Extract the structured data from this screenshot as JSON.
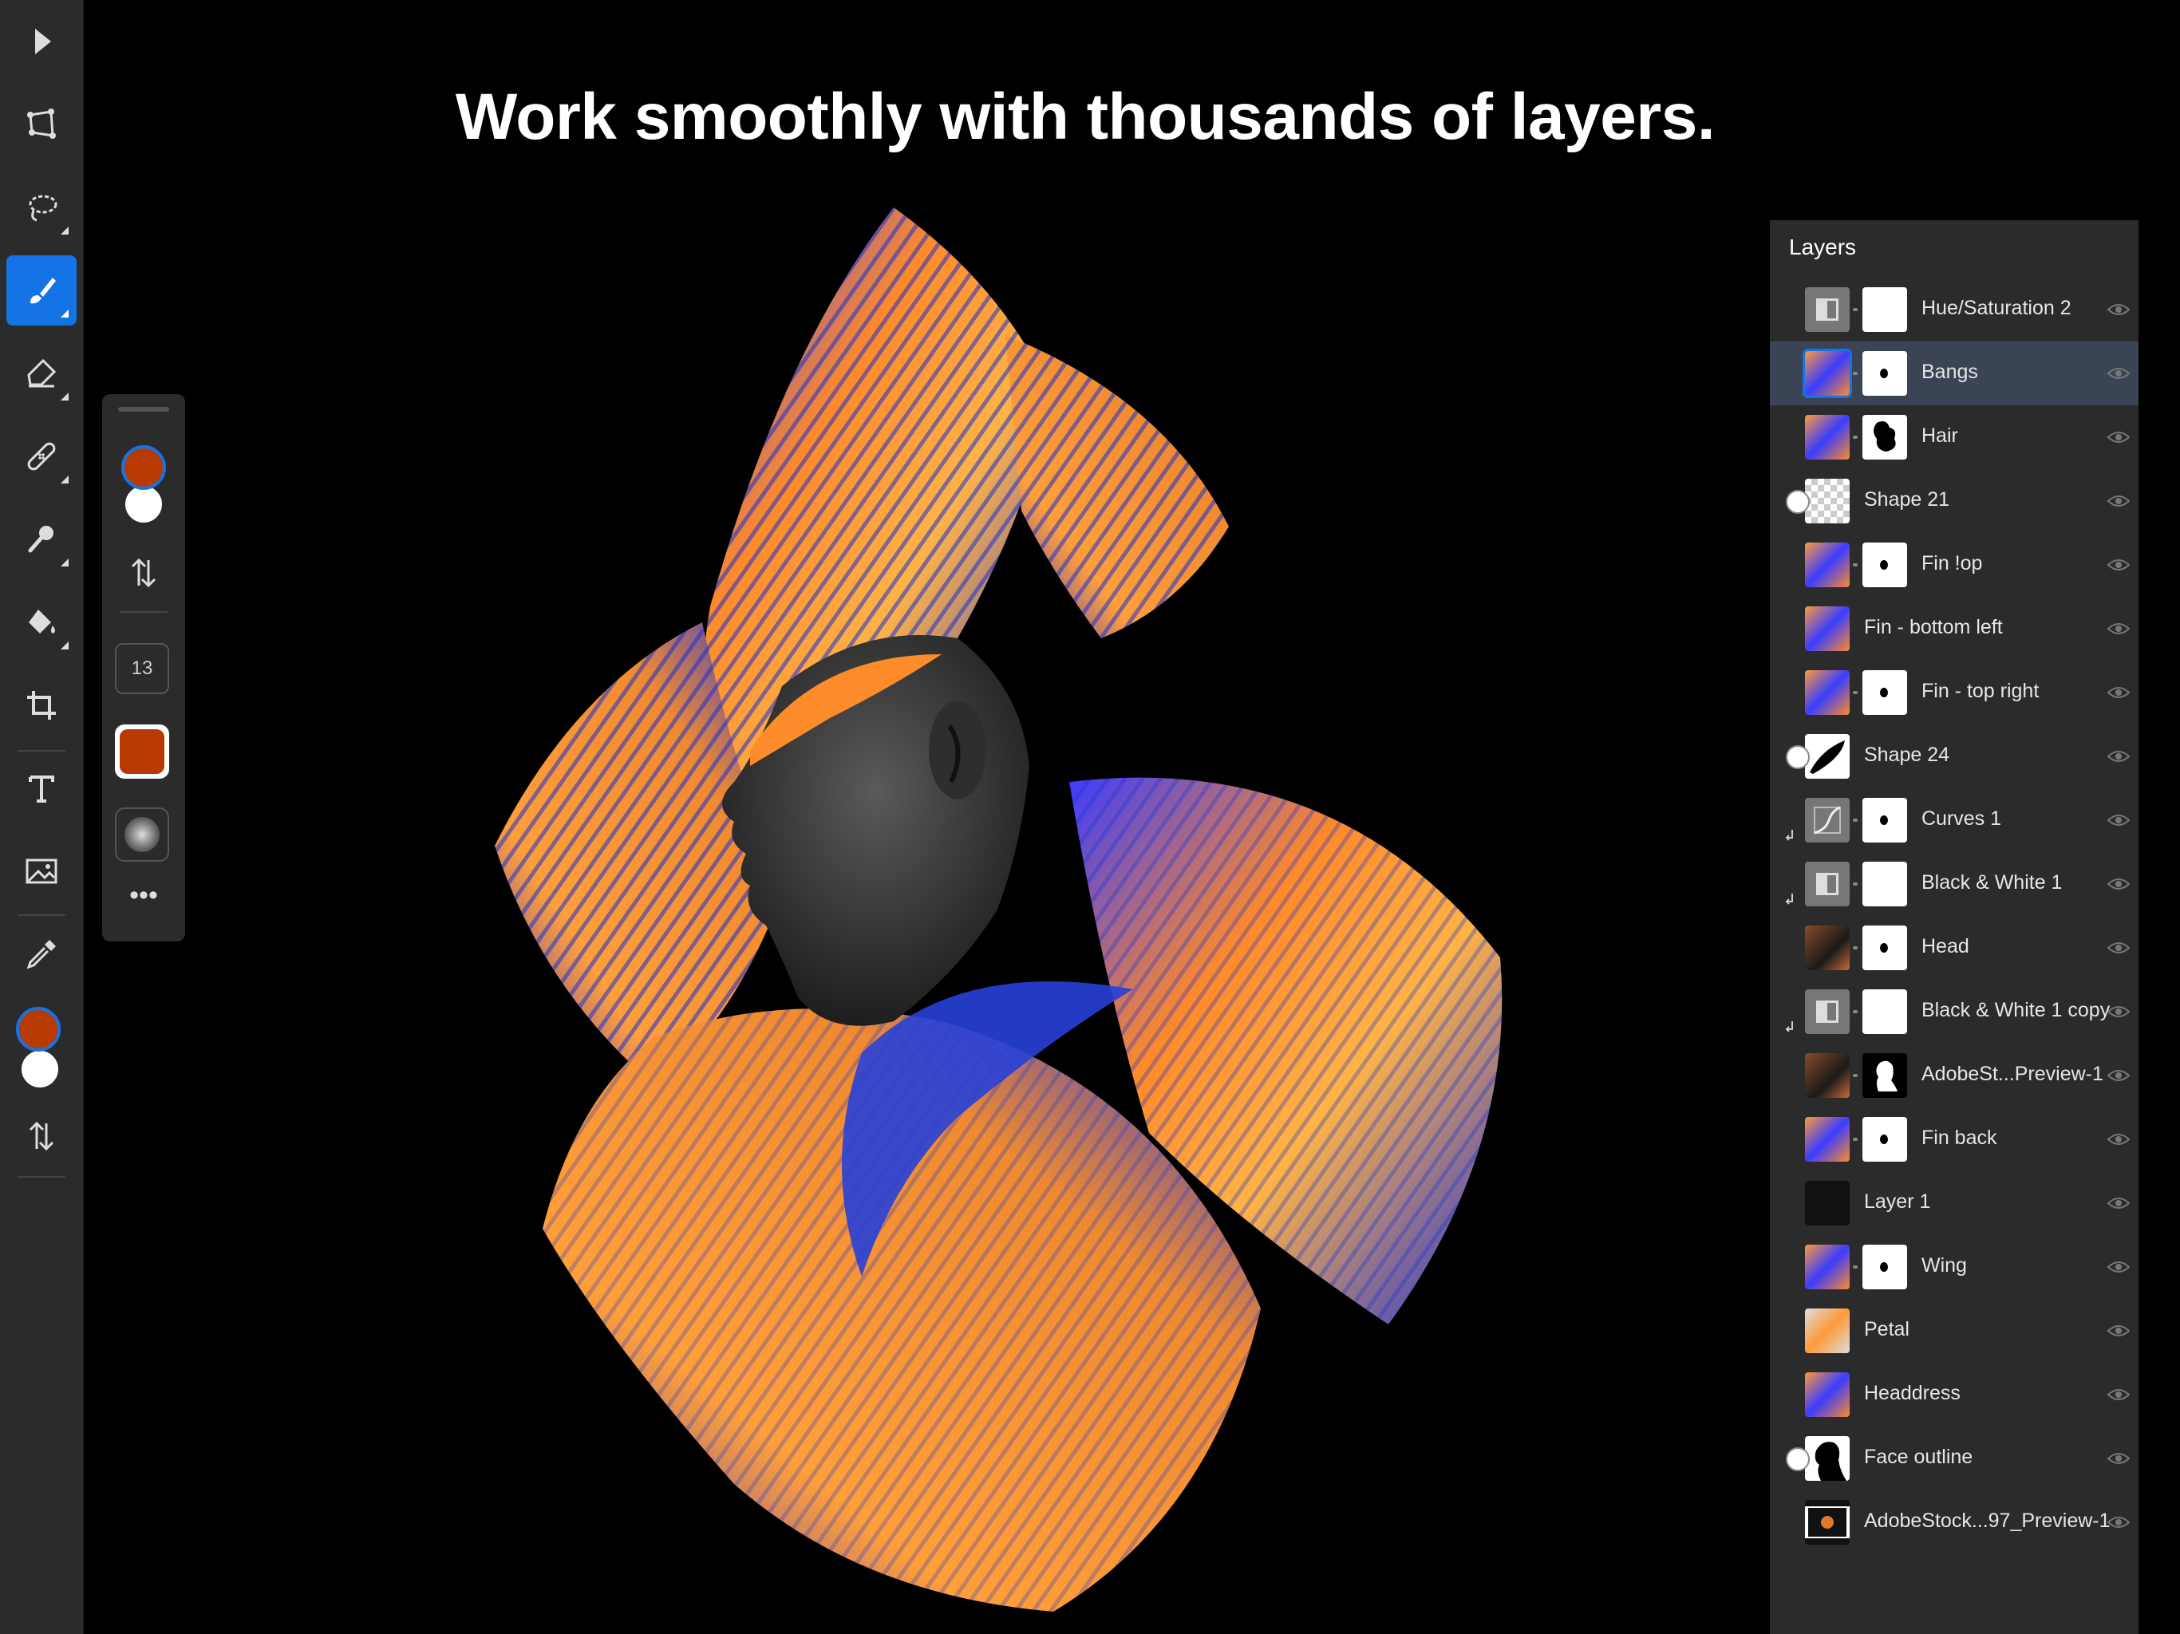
{
  "headline": "Work smoothly with thousands of layers.",
  "colors": {
    "accent": "#1473e6",
    "foreground_swatch": "#b83a00",
    "background_swatch": "#ffffff"
  },
  "toolbar": {
    "tools": [
      {
        "name": "select-arrow-icon"
      },
      {
        "name": "transform-icon"
      },
      {
        "name": "lasso-icon"
      },
      {
        "name": "brush-icon",
        "active": true
      },
      {
        "name": "eraser-icon"
      },
      {
        "name": "healing-icon"
      },
      {
        "name": "clone-stamp-icon"
      },
      {
        "name": "fill-bucket-icon"
      },
      {
        "name": "crop-icon"
      },
      {
        "name": "type-icon"
      },
      {
        "name": "place-image-icon"
      },
      {
        "name": "eyedropper-icon"
      }
    ]
  },
  "brush_options": {
    "size": "13"
  },
  "layers_panel": {
    "title": "Layers",
    "layers": [
      {
        "name": "Hue/Saturation 2",
        "kind": "adjustment",
        "mask": "white"
      },
      {
        "name": "Bangs",
        "kind": "fish",
        "mask": "dot",
        "selected": true
      },
      {
        "name": "Hair",
        "kind": "fish",
        "mask": "blot"
      },
      {
        "name": "Shape 21",
        "kind": "transparent",
        "badge": true
      },
      {
        "name": "Fin !op",
        "kind": "fish",
        "mask": "dot"
      },
      {
        "name": "Fin - bottom left",
        "kind": "fish"
      },
      {
        "name": "Fin - top right",
        "kind": "fish",
        "mask": "dot"
      },
      {
        "name": "Shape 24",
        "kind": "shape",
        "badge": true
      },
      {
        "name": "Curves 1",
        "kind": "curves",
        "mask": "dot",
        "clipped": true
      },
      {
        "name": "Black & White 1",
        "kind": "adjustment",
        "mask": "white",
        "clipped": true
      },
      {
        "name": "Head",
        "kind": "portrait",
        "mask": "dot"
      },
      {
        "name": "Black & White 1 copy",
        "kind": "adjustment",
        "mask": "white",
        "clipped": true
      },
      {
        "name": "AdobeSt...Preview-1",
        "kind": "portrait",
        "mask": "silhouette"
      },
      {
        "name": "Fin back",
        "kind": "fish",
        "mask": "dot"
      },
      {
        "name": "Layer 1",
        "kind": "black"
      },
      {
        "name": "Wing",
        "kind": "fish",
        "mask": "dot"
      },
      {
        "name": "Petal",
        "kind": "fish-transparent"
      },
      {
        "name": "Headdress",
        "kind": "fish"
      },
      {
        "name": "Face outline",
        "kind": "silhouette",
        "badge": true
      },
      {
        "name": "AdobeStock...97_Preview-1",
        "kind": "dark-photo"
      }
    ]
  }
}
